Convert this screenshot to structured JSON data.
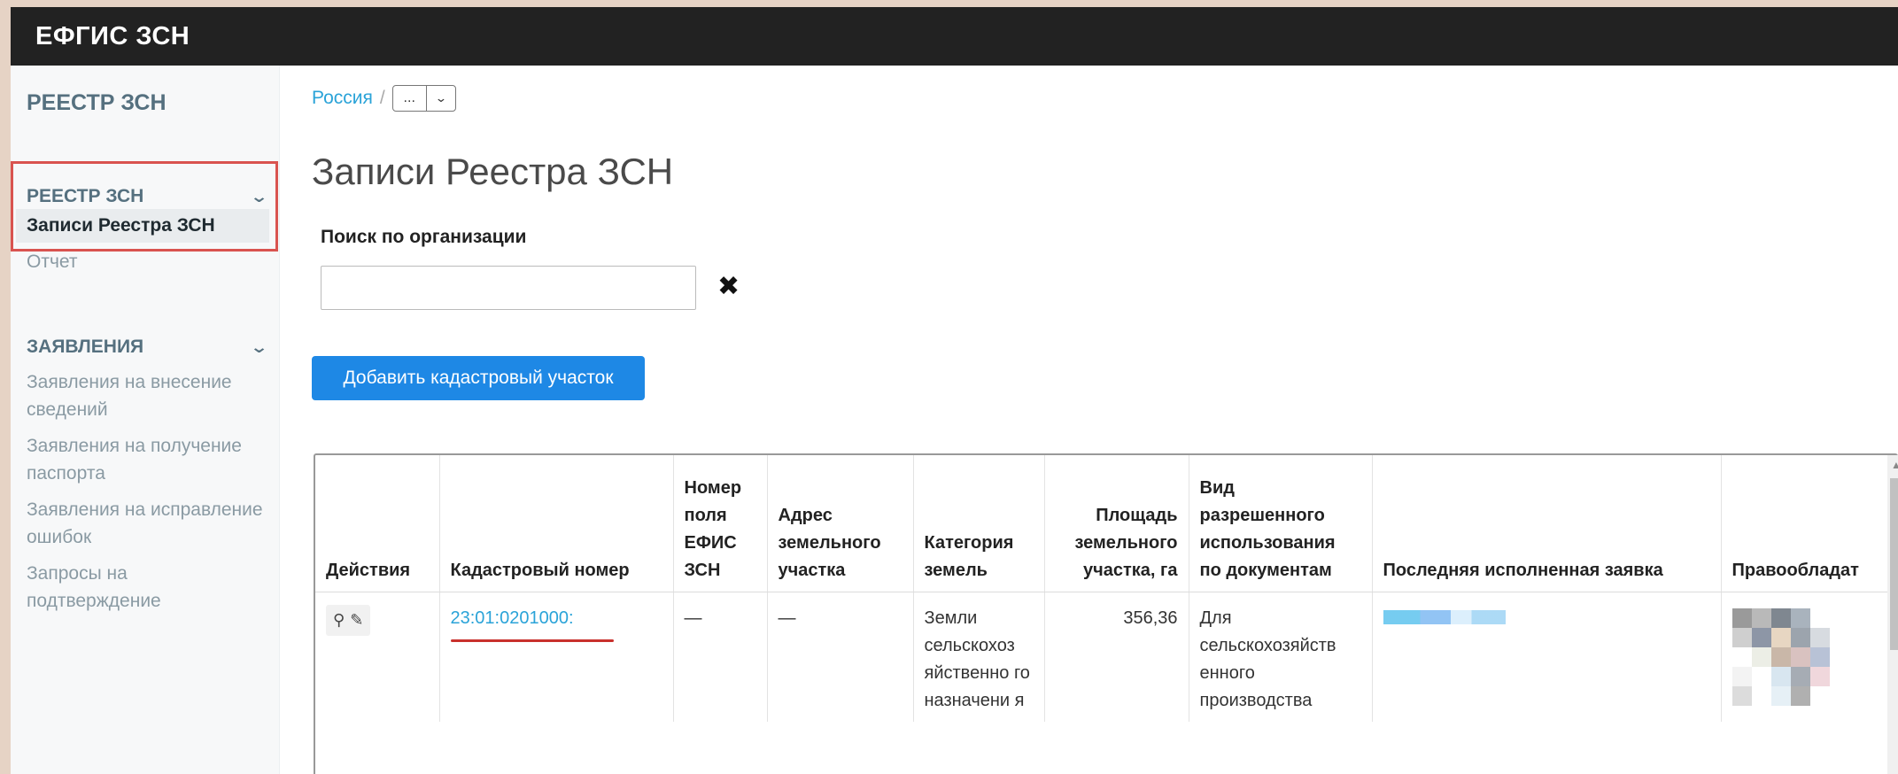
{
  "app": {
    "brand": "ЕФГИС ЗСН"
  },
  "sidebar": {
    "title": "РЕЕСТР ЗСН",
    "sections": [
      {
        "label": "РЕЕСТР ЗСН",
        "icon": "chevron-down-icon",
        "items": [
          "Записи Реестра ЗСН",
          "Отчет"
        ]
      },
      {
        "label": "ЗАЯВЛЕНИЯ",
        "icon": "chevron-down-icon",
        "items": [
          "Заявления на внесение сведений",
          "Заявления на получение паспорта",
          "Заявления на исправление ошибок",
          "Запросы на подтверждение"
        ]
      }
    ],
    "active_item": "Записи Реестра ЗСН"
  },
  "breadcrumb": {
    "root": "Россия",
    "separator": "/",
    "dropdown_label": "..."
  },
  "page": {
    "title": "Записи Реестра ЗСН",
    "search_label": "Поиск по организации",
    "search_value": "",
    "add_button_label": "Добавить кадастровый участок"
  },
  "table": {
    "columns": [
      "Действия",
      "Кадастровый номер",
      "Номер поля ЕФИС ЗСН",
      "Адрес земельного участка",
      "Категория земель",
      "Площадь земельного участка, га",
      "Вид разрешенного использования по документам",
      "Последняя исполненная заявка",
      "Правообладат"
    ],
    "rows": [
      {
        "actions": [
          "map-marker-icon",
          "pencil-icon"
        ],
        "cadastral_number": "23:01:0201000:",
        "field_number": "—",
        "address": "—",
        "category": "Земли сельскохоз яйственно го назначени я",
        "area": "356,36",
        "usage": "Для сельскохозяйств енного производства"
      }
    ]
  },
  "colors": {
    "topbar": "#222222",
    "accent": "#1e88e5",
    "link": "#2aa3d8",
    "highlight": "#d9534f"
  }
}
